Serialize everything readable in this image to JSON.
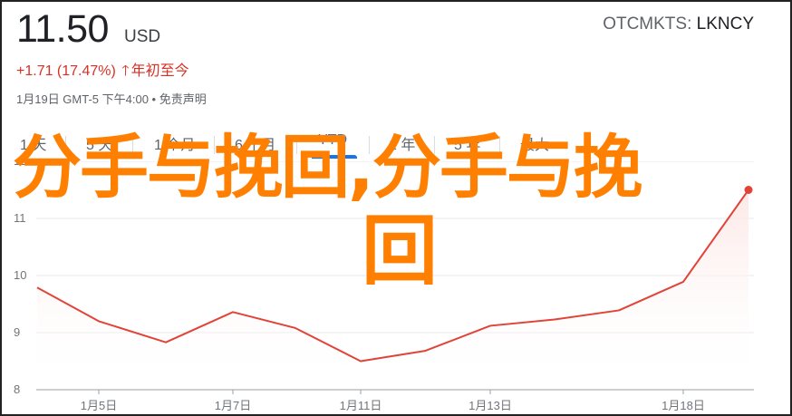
{
  "quote": {
    "price": "11.50",
    "currency": "USD",
    "exchange": "OTCMKTS",
    "symbol": "LKNCY",
    "change": "+1.71 (17.47%)",
    "change_period": "年初至今",
    "timestamp": "1月19日 GMT-5 下午4:00 • 免责声明",
    "trend_color": "#d93025"
  },
  "tabs": [
    {
      "label": "1 天"
    },
    {
      "label": "5 天"
    },
    {
      "label": "1 个月"
    },
    {
      "label": "6 个月"
    },
    {
      "label": "YTD",
      "active": true
    },
    {
      "label": "1 年"
    },
    {
      "label": "5 年"
    },
    {
      "label": "最大"
    }
  ],
  "overlay": {
    "line1": "分手与挽回,分手与挽",
    "line2": "回"
  },
  "chart_data": {
    "type": "area",
    "x": [
      "1月4日",
      "1月5日",
      "1月6日",
      "1月7日",
      "1月8日",
      "1月11日",
      "1月12日",
      "1月13日",
      "1月14日",
      "1月15日",
      "1月18日",
      "1月19日"
    ],
    "y": [
      9.79,
      9.2,
      8.83,
      9.36,
      9.08,
      8.5,
      8.68,
      9.12,
      9.23,
      9.39,
      9.89,
      11.5
    ],
    "xticks": [
      "1月5日",
      "1月7日",
      "1月11日",
      "1月13日",
      "1月18日"
    ],
    "yticks": [
      "8",
      "9",
      "10",
      "11",
      "12"
    ],
    "ylim": [
      8,
      12
    ],
    "line_color": "#e04438",
    "fill_color": "#fce8e6",
    "grid": true
  }
}
